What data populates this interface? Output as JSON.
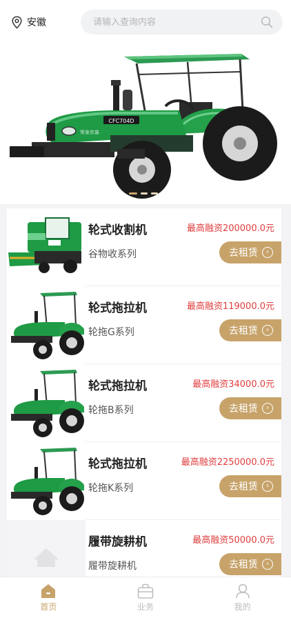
{
  "header": {
    "location": "安徽",
    "search_placeholder": "请输入查询内容"
  },
  "banner": {
    "model_plate": "CFC704D",
    "brand_text": "常发农装",
    "dots": 3,
    "active_dot": 0
  },
  "products": [
    {
      "title": "轮式收割机",
      "price": "最高融资200000.0元",
      "series": "谷物收系列",
      "button": "去租赁",
      "image": "harvester"
    },
    {
      "title": "轮式拖拉机",
      "price": "最高融资119000.0元",
      "series": "轮拖G系列",
      "button": "去租赁",
      "image": "tractor"
    },
    {
      "title": "轮式拖拉机",
      "price": "最高融资34000.0元",
      "series": "轮拖B系列",
      "button": "去租赁",
      "image": "tractor"
    },
    {
      "title": "轮式拖拉机",
      "price": "最高融资2250000.0元",
      "series": "轮拖K系列",
      "button": "去租赁",
      "image": "tractor"
    },
    {
      "title": "履带旋耕机",
      "price": "最高融资50000.0元",
      "series": "履带旋耕机",
      "button": "去租赁",
      "image": "placeholder"
    }
  ],
  "tabbar": {
    "tabs": [
      {
        "label": "首页",
        "icon": "home-icon",
        "active": true
      },
      {
        "label": "业务",
        "icon": "briefcase-icon",
        "active": false
      },
      {
        "label": "我的",
        "icon": "user-icon",
        "active": false
      }
    ]
  },
  "colors": {
    "accent": "#c7a36a",
    "price": "#e03d3d",
    "tractor_green": "#1f9a45"
  }
}
